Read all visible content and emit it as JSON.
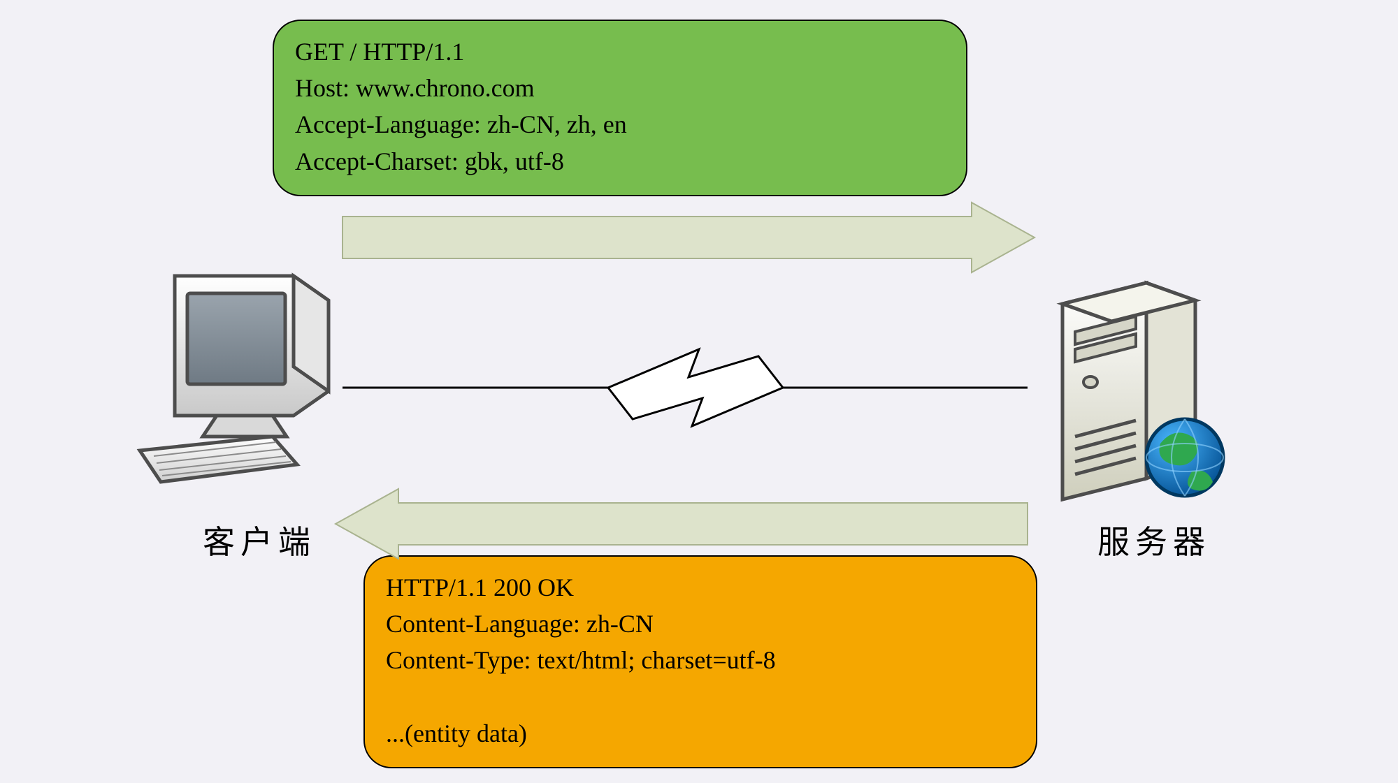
{
  "request": {
    "line1": "GET / HTTP/1.1",
    "line2": "Host: www.chrono.com",
    "line3": "Accept-Language: zh-CN, zh, en",
    "line4": "Accept-Charset: gbk, utf-8"
  },
  "response": {
    "line1": "HTTP/1.1 200 OK",
    "line2": "Content-Language: zh-CN",
    "line3": "Content-Type: text/html; charset=utf-8",
    "line4": "",
    "line5": "...(entity data)"
  },
  "labels": {
    "client": "客户端",
    "server": "服务器"
  },
  "colors": {
    "request_bg": "#77bd4e",
    "response_bg": "#f5a700",
    "arrow_fill": "#dde3cb",
    "arrow_stroke": "#a9b38f",
    "globe_blue": "#0072c6",
    "globe_green": "#2fa84f"
  }
}
